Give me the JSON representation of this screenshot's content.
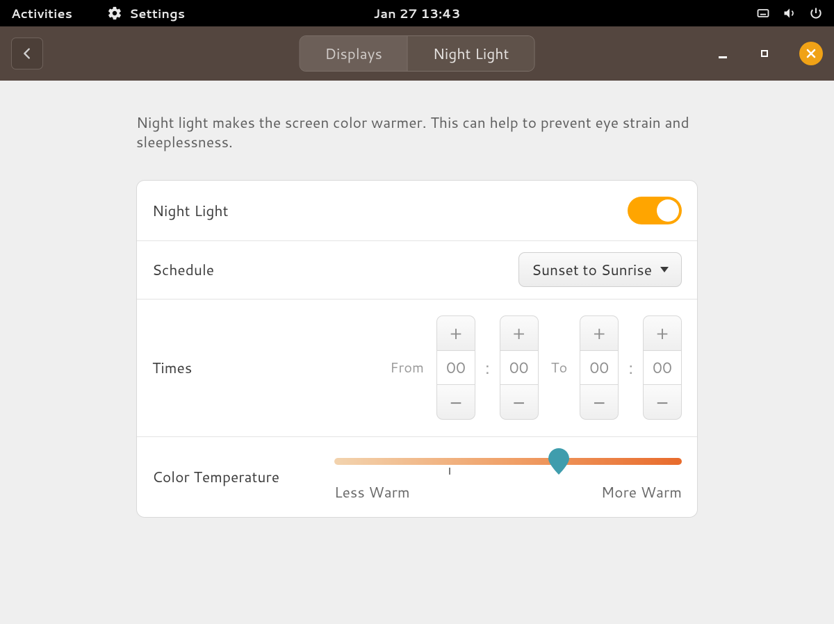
{
  "topbar": {
    "activities": "Activities",
    "app_name": "Settings",
    "datetime": "Jan 27  13:43"
  },
  "header": {
    "tab_displays": "Displays",
    "tab_nightlight": "Night Light"
  },
  "intro": "Night light makes the screen color warmer. This can help to prevent eye strain and sleeplessness.",
  "rows": {
    "night_light": {
      "label": "Night Light",
      "enabled": true
    },
    "schedule": {
      "label": "Schedule",
      "value": "Sunset to Sunrise"
    },
    "times": {
      "label": "Times",
      "from_label": "From",
      "to_label": "To",
      "from_h": "00",
      "from_m": "00",
      "to_h": "00",
      "to_m": "00"
    },
    "temp": {
      "label": "Color Temperature",
      "less": "Less Warm",
      "more": "More Warm",
      "value_pct": 64.5
    }
  }
}
